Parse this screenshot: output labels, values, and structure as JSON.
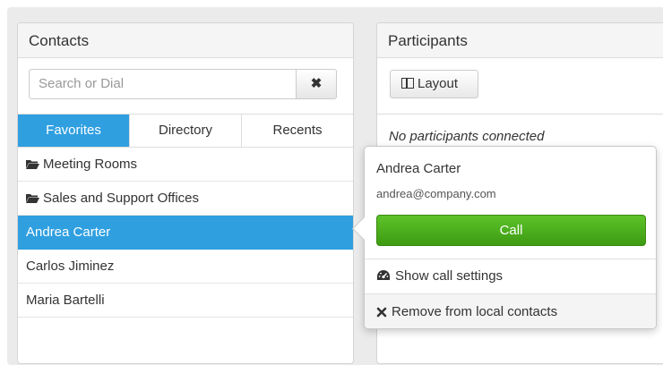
{
  "contacts": {
    "title": "Contacts",
    "search_placeholder": "Search or Dial",
    "clear_symbol": "✖",
    "tabs": [
      {
        "label": "Favorites",
        "active": true
      },
      {
        "label": "Directory",
        "active": false
      },
      {
        "label": "Recents",
        "active": false
      }
    ],
    "items": [
      {
        "label": "Meeting Rooms",
        "icon": "folder-icon"
      },
      {
        "label": "Sales and Support Offices",
        "icon": "folder-icon"
      },
      {
        "label": "Andrea Carter",
        "selected": true
      },
      {
        "label": "Carlos Jiminez"
      },
      {
        "label": "Maria Bartelli"
      }
    ]
  },
  "participants": {
    "title": "Participants",
    "layout_label": "Layout",
    "empty_text": "No participants connected"
  },
  "popover": {
    "name": "Andrea Carter",
    "email": "andrea@company.com",
    "call_label": "Call",
    "settings_label": "Show call settings",
    "remove_label": "Remove from local contacts"
  },
  "colors": {
    "accent": "#2f9fe0",
    "call_green": "#4cae1e"
  }
}
